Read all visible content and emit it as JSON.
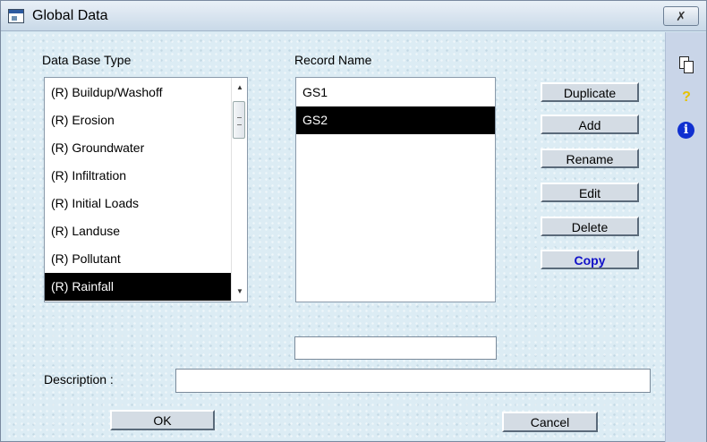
{
  "window": {
    "title": "Global Data",
    "close_glyph": "✗"
  },
  "labels": {
    "database_type": "Data Base Type",
    "record_name": "Record Name",
    "description": "Description :"
  },
  "database_types": [
    "(R) Buildup/Washoff",
    "(R) Erosion",
    "(R) Groundwater",
    "(R) Infiltration",
    "(R) Initial Loads",
    "(R) Landuse",
    "(R) Pollutant",
    "(R) Rainfall"
  ],
  "database_types_selected_index": 7,
  "records": [
    "GS1",
    "GS2"
  ],
  "records_selected_index": 1,
  "buttons": {
    "duplicate": "Duplicate",
    "add": "Add",
    "rename": "Rename",
    "edit": "Edit",
    "delete": "Delete",
    "copy": "Copy",
    "ok": "OK",
    "cancel": "Cancel"
  },
  "fields": {
    "record_name_value": "",
    "description_value": ""
  },
  "icons": {
    "side_toolbar": [
      "copy-icon",
      "help-icon",
      "info-icon"
    ],
    "help_glyph": "?",
    "info_glyph": "i",
    "scroll_up": "▲",
    "scroll_down": "▼"
  },
  "colors": {
    "selection": "#000000",
    "copy_button_text": "#1010c8",
    "info_icon": "#1030d0",
    "help_icon": "#e6c200"
  }
}
